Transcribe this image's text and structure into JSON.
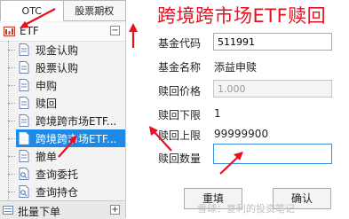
{
  "tabs": [
    {
      "label": "OTC"
    },
    {
      "label": "股票期权"
    }
  ],
  "group": {
    "label": "ETF",
    "collapse_symbol": "−"
  },
  "tree_items": [
    {
      "label": "现金认购"
    },
    {
      "label": "股票认购"
    },
    {
      "label": "申购"
    },
    {
      "label": "赎回"
    },
    {
      "label": "跨境跨市场ETF..."
    },
    {
      "label": "跨境跨市场ETF...",
      "selected": true
    },
    {
      "label": "撤单"
    },
    {
      "label": "查询委托"
    },
    {
      "label": "查询持仓"
    }
  ],
  "bottom_group": {
    "label": "批量下单",
    "expand_symbol": "+"
  },
  "form": {
    "title": "跨境跨市场ETF赎回",
    "code_label": "基金代码",
    "code_value": "511991",
    "name_label": "基金名称",
    "name_value": "添益申赎",
    "price_label": "赎回价格",
    "price_value": "1.000",
    "lower_label": "赎回下限",
    "lower_value": "1",
    "upper_label": "赎回上限",
    "upper_value": "99999900",
    "qty_label": "赎回数量",
    "qty_value": "",
    "reset_label": "重填",
    "confirm_label": "确认"
  },
  "watermark": "雪球：复利的投资笔记",
  "colors": {
    "title": "#e8101f",
    "selection": "#1e8ae6",
    "annotation": "#e8101f"
  },
  "icons": {
    "tree_item": "document-icon",
    "group": "etf-folder-icon",
    "annotation": "red-arrow"
  }
}
